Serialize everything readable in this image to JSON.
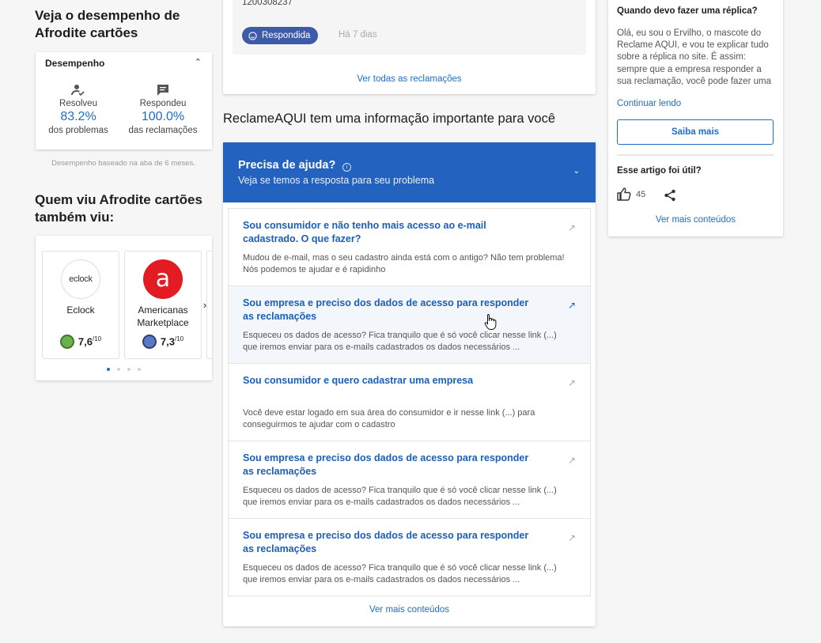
{
  "left": {
    "title": "Veja o desempenho de Afrodite cartões",
    "performance": {
      "header": "Desempenho",
      "resolved_label": "Resolveu",
      "resolved_value": "83.2%",
      "resolved_sub": "dos problemas",
      "answered_label": "Respondeu",
      "answered_value": "100.0%",
      "answered_sub": "das reclamações",
      "note": "Desempenho baseado na aba de 6 meses."
    },
    "also_viewed": {
      "title": "Quem viu Afrodite cartões também viu:",
      "companies": [
        {
          "name": "Eclock",
          "score": "7,6",
          "scale": "/10",
          "logo_text": "eclock"
        },
        {
          "name": "Americanas Marketplace",
          "score": "7,3",
          "scale": "/10",
          "logo_text": "a"
        }
      ],
      "prev_icon": "chevron-left-icon",
      "next_icon": "chevron-right-icon"
    }
  },
  "complaint": {
    "text": "1200308237",
    "status": "Respondida",
    "time": "Há 7 dias",
    "see_all": "Ver todas as reclamações"
  },
  "info_title": "ReclameAQUI tem uma informação importante para você",
  "help": {
    "title": "Precisa de ajuda?",
    "subtitle": "Veja se temos a resposta para seu problema",
    "faqs": [
      {
        "q": "Sou consumidor e não tenho mais acesso ao e-mail cadastrado. O que fazer?",
        "a": "Mudou de e-mail, mas o seu cadastro ainda está com o antigo? Não tem problema! Nós podemos te ajudar e é rapidinho"
      },
      {
        "q": "Sou empresa e preciso dos dados de acesso para responder as reclamações",
        "a": "Esqueceu os dados de acesso? Fica tranquilo que é só você clicar nesse link (...) que iremos enviar para os e-mails cadastrados os dados necessários ..."
      },
      {
        "q": "Sou consumidor e quero cadastrar uma empresa",
        "a": "Você deve estar logado em sua área do consumidor e ir nesse link (...) para conseguirmos te ajudar com o cadastro"
      },
      {
        "q": "Sou empresa e preciso dos dados de acesso para responder as reclamações",
        "a": "Esqueceu os dados de acesso? Fica tranquilo que é só você clicar nesse link (...) que iremos enviar para os e-mails cadastrados os dados necessários ..."
      },
      {
        "q": "Sou empresa e preciso dos dados de acesso para responder as reclamações",
        "a": "Esqueceu os dados de acesso? Fica tranquilo que é só você clicar nesse link (...) que iremos enviar para os e-mails cadastrados os dados necessários ..."
      }
    ],
    "see_more": "Ver mais conteúdos"
  },
  "article": {
    "question": "Quando devo fazer uma réplica?",
    "body": "Olá, eu sou o Ervilho, o mascote do Reclame AQUI, e vou te explicar tudo sobre a réplica no site. É assim: sempre que a empresa responder a sua reclamação, você pode fazer uma",
    "continue": "Continuar lendo",
    "button": "Saiba mais",
    "useful": "Esse artigo foi útil?",
    "likes": "45",
    "see_more": "Ver mais conteúdos"
  },
  "colors": {
    "brand_blue": "#2462c0",
    "link_blue": "#1b6fc9",
    "badge": "#3e5ba9"
  }
}
